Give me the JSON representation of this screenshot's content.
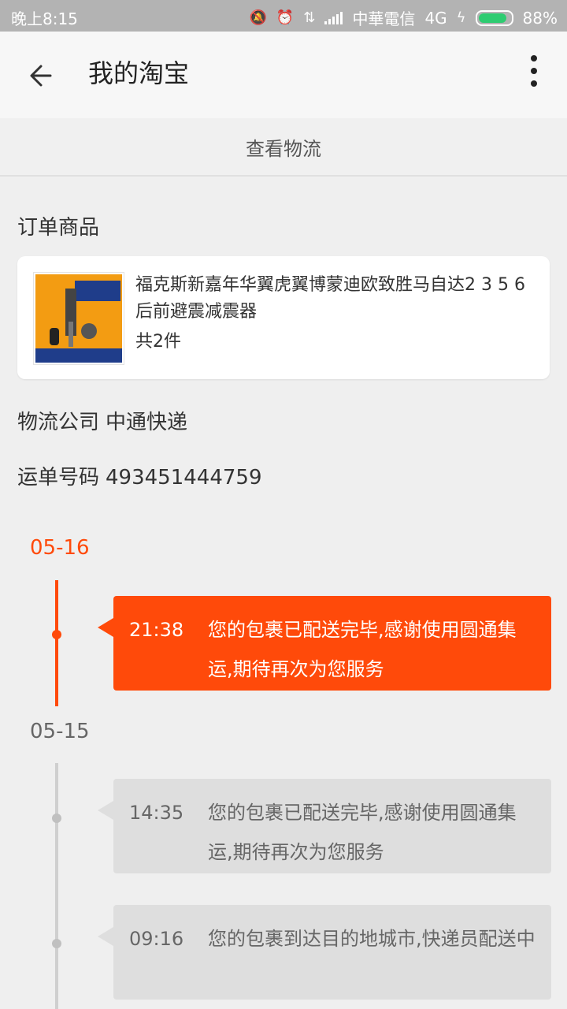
{
  "status_bar": {
    "time": "晚上8:15",
    "carrier": "中華電信",
    "network": "4G",
    "battery": "88%",
    "battery_level": 0.88,
    "icons": [
      "mute-icon",
      "alarm-icon",
      "data-arrows-icon",
      "signal-icon",
      "charging-icon",
      "battery-icon"
    ]
  },
  "header": {
    "title": "我的淘宝",
    "back_icon": "back-arrow-icon",
    "more_icon": "more-vert-icon"
  },
  "tab": {
    "label": "查看物流"
  },
  "order": {
    "section_title": "订单商品",
    "product": {
      "name": "福克斯新嘉年华翼虎翼博蒙迪欧致胜马自达2 3 5 6后前避震减震器",
      "quantity": "共2件"
    }
  },
  "logistics": {
    "company_label": "物流公司",
    "company": "中通快递",
    "tracking_label": "运单号码",
    "tracking_number": "493451444759"
  },
  "timeline": [
    {
      "date": "05-16",
      "events": [
        {
          "time": "21:38",
          "message": "您的包裹已配送完毕,感谢使用圆通集运,期待再次为您服务"
        }
      ]
    },
    {
      "date": "05-15",
      "events": [
        {
          "time": "14:35",
          "message": "您的包裹已配送完毕,感谢使用圆通集运,期待再次为您服务"
        },
        {
          "time": "09:16",
          "message": "您的包裹到达目的地城市,快递员配送中"
        }
      ]
    }
  ],
  "colors": {
    "accent": "#ff4a0a",
    "status_bar": "#b3b3b3"
  }
}
